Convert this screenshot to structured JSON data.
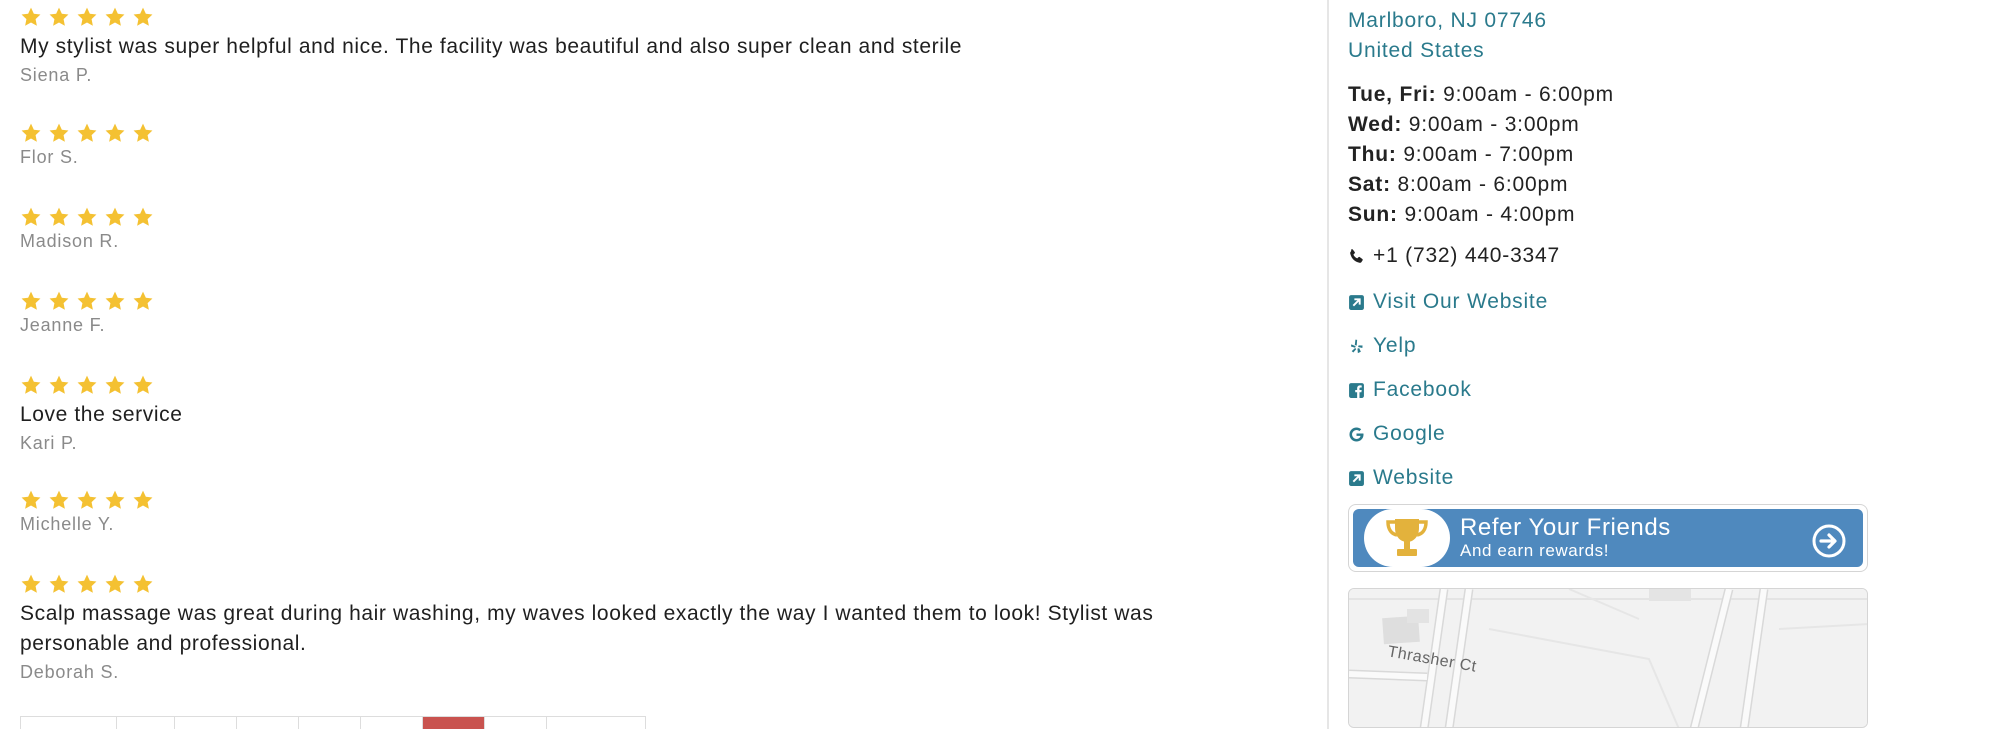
{
  "reviews": [
    {
      "rating": 5,
      "text": "My stylist was super helpful and nice. The facility was beautiful and also super clean and sterile",
      "author": "Siena P."
    },
    {
      "rating": 5,
      "text": "",
      "author": "Flor S."
    },
    {
      "rating": 5,
      "text": "",
      "author": "Madison R."
    },
    {
      "rating": 5,
      "text": "",
      "author": "Jeanne F."
    },
    {
      "rating": 5,
      "text": "Love the service",
      "author": "Kari P."
    },
    {
      "rating": 5,
      "text": "",
      "author": "Michelle Y."
    },
    {
      "rating": 5,
      "text": "Scalp massage was great during hair washing, my waves looked exactly the way I wanted them to look! Stylist was personable and professional.",
      "author": "Deborah S."
    }
  ],
  "pagination": {
    "active_index": 6,
    "cell_count": 9
  },
  "sidebar": {
    "address": {
      "city_line": "Marlboro, NJ 07746",
      "country": "United States"
    },
    "hours": [
      {
        "day": "Tue, Fri:",
        "time": "9:00am - 6:00pm"
      },
      {
        "day": "Wed:",
        "time": "9:00am - 3:00pm"
      },
      {
        "day": "Thu:",
        "time": "9:00am - 7:00pm"
      },
      {
        "day": "Sat:",
        "time": "8:00am - 6:00pm"
      },
      {
        "day": "Sun:",
        "time": "9:00am - 4:00pm"
      }
    ],
    "phone": "+1 (732) 440-3347",
    "links": [
      {
        "label": "Visit Our Website",
        "icon": "external-link-icon"
      },
      {
        "label": "Yelp",
        "icon": "yelp-icon"
      },
      {
        "label": "Facebook",
        "icon": "facebook-icon"
      },
      {
        "label": "Google",
        "icon": "google-icon"
      },
      {
        "label": "Website",
        "icon": "external-link-icon"
      }
    ],
    "refer": {
      "title": "Refer Your Friends",
      "subtitle": "And earn rewards!"
    },
    "map": {
      "street_label": "Thrasher Ct"
    }
  },
  "colors": {
    "star": "#f4c132",
    "link": "#2a7a8c",
    "refer_bg": "#4f89be",
    "page_active": "#c9534f"
  }
}
